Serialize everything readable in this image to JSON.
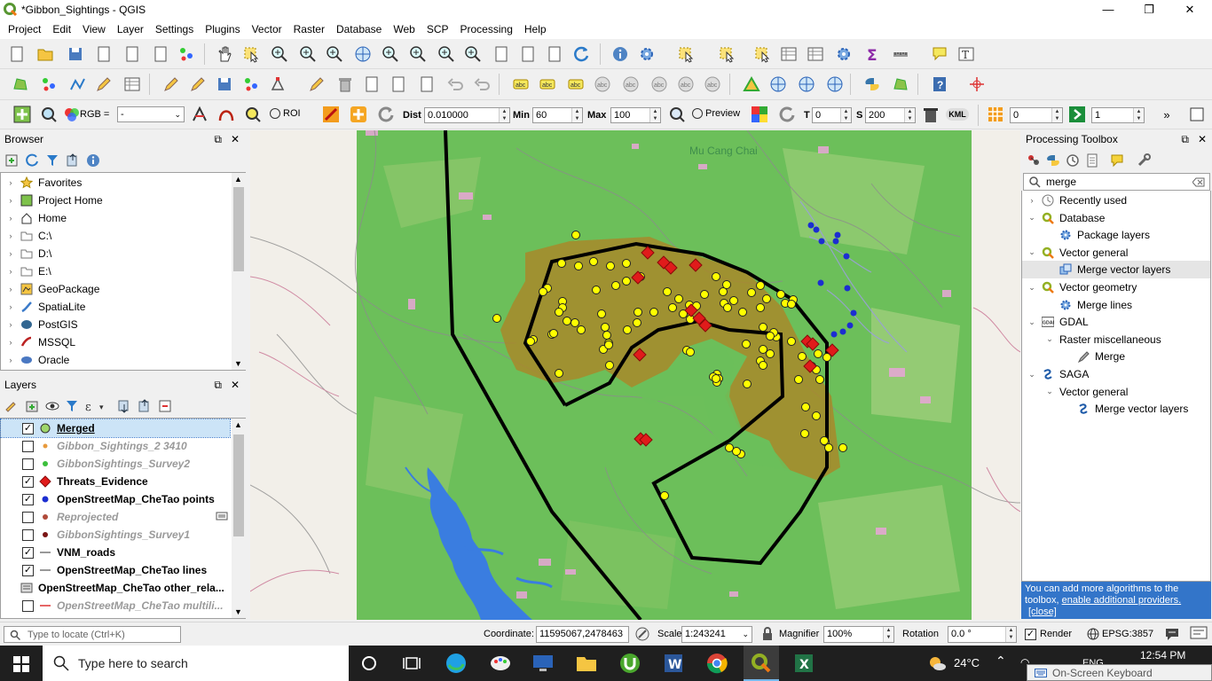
{
  "window": {
    "title": "*Gibbon_Sightings - QGIS",
    "minimize": "—",
    "restore": "❐",
    "close": "✕"
  },
  "menu": [
    "Project",
    "Edit",
    "View",
    "Layer",
    "Settings",
    "Plugins",
    "Vector",
    "Raster",
    "Database",
    "Web",
    "SCP",
    "Processing",
    "Help"
  ],
  "scp_bar": {
    "rgb_label": "RGB =",
    "rgb_value": "-",
    "roi_label": "ROI",
    "dist_label": "Dist",
    "dist_value": "0.010000",
    "min_label": "Min",
    "min_value": "60",
    "max_label": "Max",
    "max_value": "100",
    "preview_label": "Preview",
    "t_label": "T",
    "t_value": "0",
    "s_label": "S",
    "s_value": "200",
    "kml_label": "KML",
    "band_value": "0",
    "step_value": "1"
  },
  "browser": {
    "title": "Browser",
    "items": [
      "Favorites",
      "Project Home",
      "Home",
      "C:\\",
      "D:\\",
      "E:\\",
      "GeoPackage",
      "SpatiaLite",
      "PostGIS",
      "MSSQL",
      "Oracle"
    ]
  },
  "layers": {
    "title": "Layers",
    "items": [
      {
        "name": "Merged",
        "checked": true,
        "style": "bold-underline",
        "sym": "yellow-point"
      },
      {
        "name": "Gibbon_Sightings_2 3410",
        "checked": false,
        "style": "grey-italic",
        "sym": "orange-point-small"
      },
      {
        "name": "GibbonSightings_Survey2",
        "checked": false,
        "style": "grey-italic",
        "sym": "green-point"
      },
      {
        "name": "Threats_Evidence",
        "checked": true,
        "style": "bold",
        "sym": "red-diamond"
      },
      {
        "name": "OpenStreetMap_CheTao points",
        "checked": true,
        "style": "bold",
        "sym": "blue-point"
      },
      {
        "name": "Reprojected",
        "checked": false,
        "style": "grey-italic",
        "sym": "brown-point"
      },
      {
        "name": "GibbonSightings_Survey1",
        "checked": false,
        "style": "grey-italic",
        "sym": "darkred-point"
      },
      {
        "name": "VNM_roads",
        "checked": true,
        "style": "bold",
        "sym": "grey-line"
      },
      {
        "name": "OpenStreetMap_CheTao lines",
        "checked": true,
        "style": "bold",
        "sym": "grey-line"
      },
      {
        "name": "OpenStreetMap_CheTao other_rela...",
        "checked": null,
        "style": "bold",
        "sym": "group"
      },
      {
        "name": "OpenStreetMap_CheTao multili...",
        "checked": false,
        "style": "grey-italic",
        "sym": "red-line"
      }
    ]
  },
  "map": {
    "place_label": "Mu Cang Chai"
  },
  "toolbox": {
    "title": "Processing Toolbox",
    "search_value": "merge",
    "tree": [
      {
        "label": "Recently used",
        "indent": 0,
        "chev": "›",
        "icon": "clock-icon"
      },
      {
        "label": "Database",
        "indent": 0,
        "chev": "⌄",
        "icon": "qgis-icon"
      },
      {
        "label": "Package layers",
        "indent": 1,
        "chev": "",
        "icon": "gear-icon"
      },
      {
        "label": "Vector general",
        "indent": 0,
        "chev": "⌄",
        "icon": "qgis-icon"
      },
      {
        "label": "Merge vector layers",
        "indent": 1,
        "chev": "",
        "icon": "merge-icon",
        "selected": true
      },
      {
        "label": "Vector geometry",
        "indent": 0,
        "chev": "⌄",
        "icon": "qgis-icon"
      },
      {
        "label": "Merge lines",
        "indent": 1,
        "chev": "",
        "icon": "gear-icon"
      },
      {
        "label": "GDAL",
        "indent": 0,
        "chev": "⌄",
        "icon": "gdal-icon"
      },
      {
        "label": "Raster miscellaneous",
        "indent": 1,
        "chev": "⌄",
        "icon": ""
      },
      {
        "label": "Merge",
        "indent": 2,
        "chev": "",
        "icon": "brush-icon"
      },
      {
        "label": "SAGA",
        "indent": 0,
        "chev": "⌄",
        "icon": "saga-icon"
      },
      {
        "label": "Vector general",
        "indent": 1,
        "chev": "⌄",
        "icon": ""
      },
      {
        "label": "Merge vector layers",
        "indent": 2,
        "chev": "",
        "icon": "saga-icon"
      }
    ],
    "info_text": "You can add more algorithms to the toolbox,",
    "info_link": "enable additional providers.",
    "info_close": "[close]"
  },
  "status": {
    "locate_placeholder": "Type to locate (Ctrl+K)",
    "coord_label": "Coordinate:",
    "coord_value": "11595067,2478463",
    "scale_label": "Scale",
    "scale_value": "1:243241",
    "magnifier_label": "Magnifier",
    "magnifier_value": "100%",
    "rotation_label": "Rotation",
    "rotation_value": "0.0 °",
    "render_label": "Render",
    "crs": "EPSG:3857"
  },
  "taskbar": {
    "search_placeholder": "Type here to search",
    "weather": "24°C",
    "time": "12:54 PM",
    "lang": "ENG",
    "osk": "On-Screen Keyboard"
  },
  "colors": {
    "accent": "#3375c9",
    "selection": "#cce4f7",
    "polygon": "#a8882a",
    "green": "#6cbf5a",
    "sighting": "#ffff00",
    "threat": "#e01b1b",
    "osm_point": "#1c2ed1"
  }
}
